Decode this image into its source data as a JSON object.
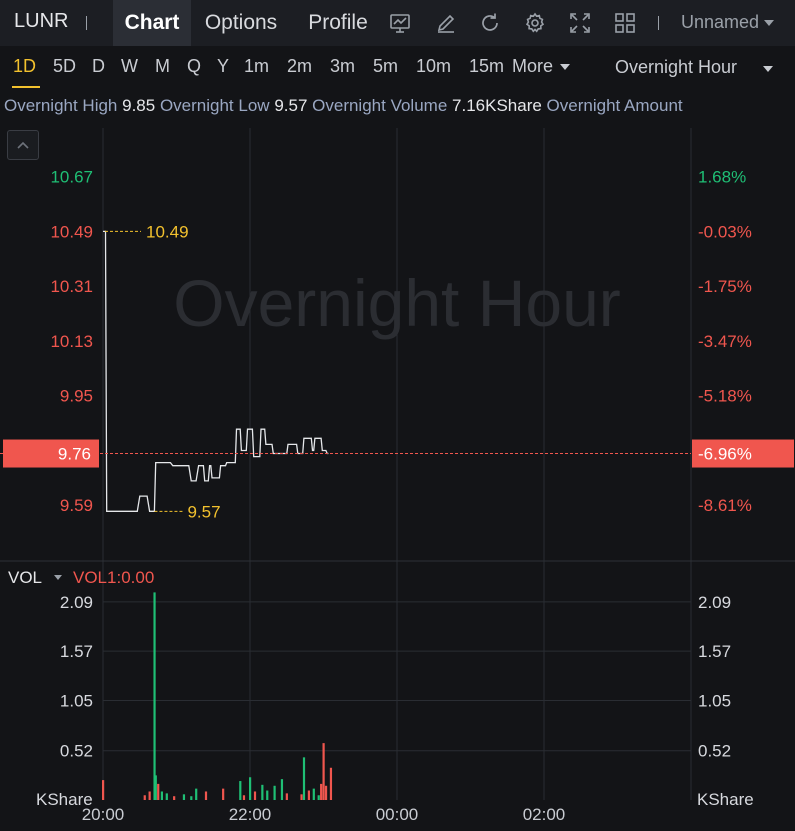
{
  "header": {
    "ticker": "LUNR",
    "tabs": [
      {
        "label": "Chart",
        "active": true
      },
      {
        "label": "Options",
        "active": false
      },
      {
        "label": "Profile",
        "active": false
      }
    ],
    "tools": [
      "indicator-chart-icon",
      "draw-pen-icon",
      "refresh-icon",
      "settings-gear-icon",
      "fullscreen-icon",
      "layout-grid-icon"
    ],
    "layout_name": "Unnamed"
  },
  "periods": {
    "items": [
      "1D",
      "5D",
      "D",
      "W",
      "M",
      "Q",
      "Y",
      "1m",
      "2m",
      "3m",
      "5m",
      "10m",
      "15m"
    ],
    "active": "1D",
    "more_label": "More",
    "session_label": "Overnight Hour"
  },
  "info": [
    {
      "label": "Overnight High",
      "value": "9.85"
    },
    {
      "label": "Overnight Low",
      "value": "9.57"
    },
    {
      "label": "Overnight Volume",
      "value": "7.16KShare"
    },
    {
      "label": "Overnight Amount",
      "value": ""
    }
  ],
  "colors": {
    "up": "#1fbf75",
    "down": "#f0564e",
    "highlight": "#f2c12e",
    "price_line": "#e5e7ea",
    "grid": "#2a2d33",
    "bg": "#131417"
  },
  "chart_data": [
    {
      "type": "line",
      "watermark": "Overnight Hour",
      "x_ticks": [
        "20:00",
        "22:00",
        "00:00",
        "02:00"
      ],
      "y_ticks_left": [
        "10.67",
        "10.49",
        "10.31",
        "10.13",
        "9.95",
        "9.76",
        "9.59"
      ],
      "y_ticks_right": [
        "1.68%",
        "-0.03%",
        "-1.75%",
        "-3.47%",
        "-5.18%",
        "-6.96%",
        "-8.61%"
      ],
      "ylim": [
        9.41,
        10.83
      ],
      "current_price": {
        "price": 9.76,
        "label": "9.76",
        "pct": "-6.96%"
      },
      "high_marker": {
        "price": 10.49,
        "label": "10.49"
      },
      "low_marker": {
        "price": 9.57,
        "label": "9.57"
      },
      "x_minutes_range": [
        0,
        480
      ],
      "points": [
        [
          0,
          10.49
        ],
        [
          2,
          10.49
        ],
        [
          3,
          9.57
        ],
        [
          28,
          9.57
        ],
        [
          30,
          9.62
        ],
        [
          36,
          9.62
        ],
        [
          38,
          9.57
        ],
        [
          42,
          9.57
        ],
        [
          43,
          9.73
        ],
        [
          55,
          9.73
        ],
        [
          57,
          9.72
        ],
        [
          70,
          9.72
        ],
        [
          72,
          9.67
        ],
        [
          76,
          9.67
        ],
        [
          78,
          9.72
        ],
        [
          82,
          9.72
        ],
        [
          83,
          9.67
        ],
        [
          86,
          9.67
        ],
        [
          87,
          9.72
        ],
        [
          88,
          9.72
        ],
        [
          89,
          9.68
        ],
        [
          95,
          9.68
        ],
        [
          96,
          9.72
        ],
        [
          100,
          9.72
        ],
        [
          101,
          9.73
        ],
        [
          108,
          9.73
        ],
        [
          109,
          9.84
        ],
        [
          112,
          9.84
        ],
        [
          113,
          9.77
        ],
        [
          117,
          9.77
        ],
        [
          118,
          9.84
        ],
        [
          122,
          9.84
        ],
        [
          123,
          9.75
        ],
        [
          128,
          9.75
        ],
        [
          129,
          9.84
        ],
        [
          132,
          9.84
        ],
        [
          133,
          9.79
        ],
        [
          138,
          9.79
        ],
        [
          139,
          9.76
        ],
        [
          150,
          9.76
        ],
        [
          151,
          9.79
        ],
        [
          158,
          9.79
        ],
        [
          159,
          9.76
        ],
        [
          163,
          9.76
        ],
        [
          164,
          9.81
        ],
        [
          170,
          9.81
        ],
        [
          171,
          9.77
        ],
        [
          172,
          9.77
        ],
        [
          173,
          9.81
        ],
        [
          178,
          9.81
        ],
        [
          179,
          9.77
        ],
        [
          182,
          9.77
        ],
        [
          183,
          9.76
        ],
        [
          184,
          9.76
        ]
      ]
    },
    {
      "type": "bar",
      "title": "VOL",
      "indicator": "VOL1:0.00",
      "y_ticks": [
        "2.09",
        "1.57",
        "1.05",
        "0.52"
      ],
      "unit": "KShare",
      "ylim": [
        0,
        2.5
      ],
      "bars": [
        {
          "t": 0,
          "v": 0.21,
          "dir": "down"
        },
        {
          "t": 34,
          "v": 0.05,
          "dir": "down"
        },
        {
          "t": 38,
          "v": 0.09,
          "dir": "down"
        },
        {
          "t": 42,
          "v": 2.19,
          "dir": "up"
        },
        {
          "t": 43,
          "v": 0.26,
          "dir": "up"
        },
        {
          "t": 45,
          "v": 0.17,
          "dir": "down"
        },
        {
          "t": 48,
          "v": 0.09,
          "dir": "up"
        },
        {
          "t": 52,
          "v": 0.07,
          "dir": "up"
        },
        {
          "t": 58,
          "v": 0.04,
          "dir": "down"
        },
        {
          "t": 66,
          "v": 0.06,
          "dir": "up"
        },
        {
          "t": 72,
          "v": 0.04,
          "dir": "up"
        },
        {
          "t": 76,
          "v": 0.12,
          "dir": "up"
        },
        {
          "t": 84,
          "v": 0.09,
          "dir": "down"
        },
        {
          "t": 98,
          "v": 0.12,
          "dir": "down"
        },
        {
          "t": 112,
          "v": 0.2,
          "dir": "up"
        },
        {
          "t": 115,
          "v": 0.05,
          "dir": "down"
        },
        {
          "t": 120,
          "v": 0.24,
          "dir": "up"
        },
        {
          "t": 124,
          "v": 0.09,
          "dir": "down"
        },
        {
          "t": 130,
          "v": 0.16,
          "dir": "up"
        },
        {
          "t": 134,
          "v": 0.1,
          "dir": "up"
        },
        {
          "t": 140,
          "v": 0.15,
          "dir": "up"
        },
        {
          "t": 146,
          "v": 0.22,
          "dir": "up"
        },
        {
          "t": 150,
          "v": 0.07,
          "dir": "down"
        },
        {
          "t": 162,
          "v": 0.06,
          "dir": "down"
        },
        {
          "t": 164,
          "v": 0.45,
          "dir": "up"
        },
        {
          "t": 168,
          "v": 0.1,
          "dir": "down"
        },
        {
          "t": 172,
          "v": 0.12,
          "dir": "up"
        },
        {
          "t": 176,
          "v": 0.05,
          "dir": "up"
        },
        {
          "t": 178,
          "v": 0.17,
          "dir": "down"
        },
        {
          "t": 180,
          "v": 0.6,
          "dir": "down"
        },
        {
          "t": 182,
          "v": 0.15,
          "dir": "down"
        },
        {
          "t": 186,
          "v": 0.34,
          "dir": "down"
        }
      ]
    }
  ]
}
